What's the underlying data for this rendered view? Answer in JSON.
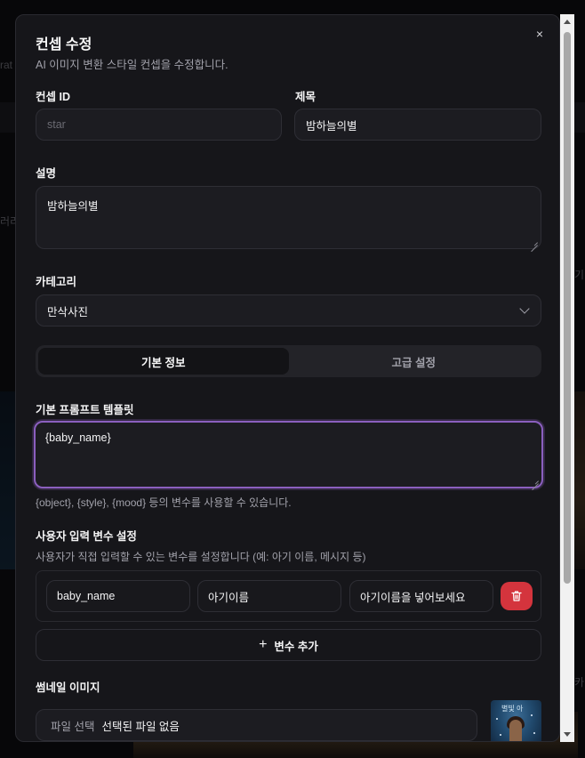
{
  "background": {
    "fragments": [
      "rat",
      "러리",
      "기",
      "카"
    ]
  },
  "dialog": {
    "title": "컨셉 수정",
    "subtitle": "AI 이미지 변환 스타일 컨셉을 수정합니다.",
    "close_icon": "×"
  },
  "form": {
    "concept_id": {
      "label": "컨셉 ID",
      "placeholder": "star"
    },
    "title": {
      "label": "제목",
      "value": "밤하늘의별"
    },
    "description": {
      "label": "설명",
      "value": "밤하늘의별"
    },
    "category": {
      "label": "카테고리",
      "selected": "만삭사진"
    }
  },
  "tabs": [
    {
      "label": "기본 정보",
      "active": true
    },
    {
      "label": "고급 설정",
      "active": false
    }
  ],
  "prompt": {
    "label": "기본 프롬프트 템플릿",
    "value": "{baby_name}",
    "hint": "{object}, {style}, {mood} 등의 변수를 사용할 수 있습니다."
  },
  "variables": {
    "label": "사용자 입력 변수 설정",
    "hint": "사용자가 직접 입력할 수 있는 변수를 설정합니다 (예: 아기 이름, 메시지 등)",
    "rows": [
      {
        "name": "baby_name",
        "display": "아기이름",
        "placeholder_text": "아기이름을 넣어보세요"
      }
    ],
    "add_label": "변수 추가",
    "add_icon": "+"
  },
  "thumbnail": {
    "label": "썸네일 이미지",
    "file_button": "파일 선택",
    "file_status": "선택된 파일 없음",
    "thumb_text": "별빛 아"
  },
  "colors": {
    "accent_focus": "#8b5fbf",
    "danger": "#d4343d"
  }
}
